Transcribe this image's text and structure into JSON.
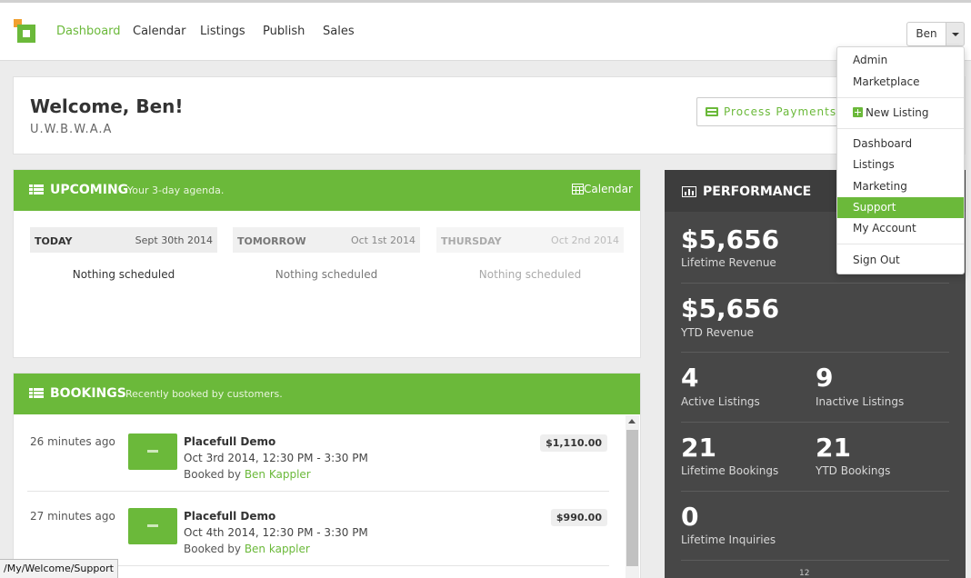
{
  "nav": {
    "items": [
      {
        "label": "Dashboard",
        "active": true
      },
      {
        "label": "Calendar",
        "active": false
      },
      {
        "label": "Listings",
        "active": false
      },
      {
        "label": "Publish",
        "active": false
      },
      {
        "label": "Sales",
        "active": false
      }
    ],
    "user": "Ben"
  },
  "welcome": {
    "title": "Welcome, Ben!",
    "org": "U.W.B.W.A.A",
    "process_payments": "Process Payments"
  },
  "upcoming": {
    "title": "UPCOMING",
    "subtitle": "Your 3-day agenda.",
    "calendar_link": "Calendar",
    "days": [
      {
        "name": "TODAY",
        "date": "Sept 30th 2014",
        "note": "Nothing scheduled"
      },
      {
        "name": "TOMORROW",
        "date": "Oct 1st 2014",
        "note": "Nothing scheduled"
      },
      {
        "name": "THURSDAY",
        "date": "Oct 2nd 2014",
        "note": "Nothing scheduled"
      }
    ]
  },
  "bookings": {
    "title": "BOOKINGS",
    "subtitle": "Recently booked by customers.",
    "rows": [
      {
        "time": "26 minutes ago",
        "title": "Placefull Demo",
        "date": "Oct 3rd 2014, 12:30 PM - 3:30 PM",
        "by_label": "Booked by",
        "by_name": "Ben Kappler",
        "price": "$1,110.00"
      },
      {
        "time": "27 minutes ago",
        "title": "Placefull Demo",
        "date": "Oct 4th 2014, 12:30 PM - 3:30 PM",
        "by_label": "Booked by",
        "by_name": "Ben kappler",
        "price": "$990.00"
      }
    ]
  },
  "performance": {
    "title": "PERFORMANCE",
    "lifetime_revenue": {
      "value": "$5,656",
      "label": "Lifetime Revenue"
    },
    "ytd_revenue": {
      "value": "$5,656",
      "label": "YTD Revenue"
    },
    "active_listings": {
      "value": "4",
      "label": "Active Listings"
    },
    "inactive_listings": {
      "value": "9",
      "label": "Inactive Listings"
    },
    "lifetime_bookings": {
      "value": "21",
      "label": "Lifetime Bookings"
    },
    "ytd_bookings": {
      "value": "21",
      "label": "YTD Bookings"
    },
    "lifetime_inquiries": {
      "value": "0",
      "label": "Lifetime Inquiries"
    },
    "partial": "12"
  },
  "dropdown": {
    "admin": "Admin",
    "marketplace": "Marketplace",
    "new_listing": "New Listing",
    "dashboard": "Dashboard",
    "listings": "Listings",
    "marketing": "Marketing",
    "support": "Support",
    "my_account": "My Account",
    "sign_out": "Sign Out"
  },
  "status_url": "/My/Welcome/Support",
  "colors": {
    "accent": "#6bb93a",
    "dark_panel": "#474747",
    "background": "#ececec"
  }
}
